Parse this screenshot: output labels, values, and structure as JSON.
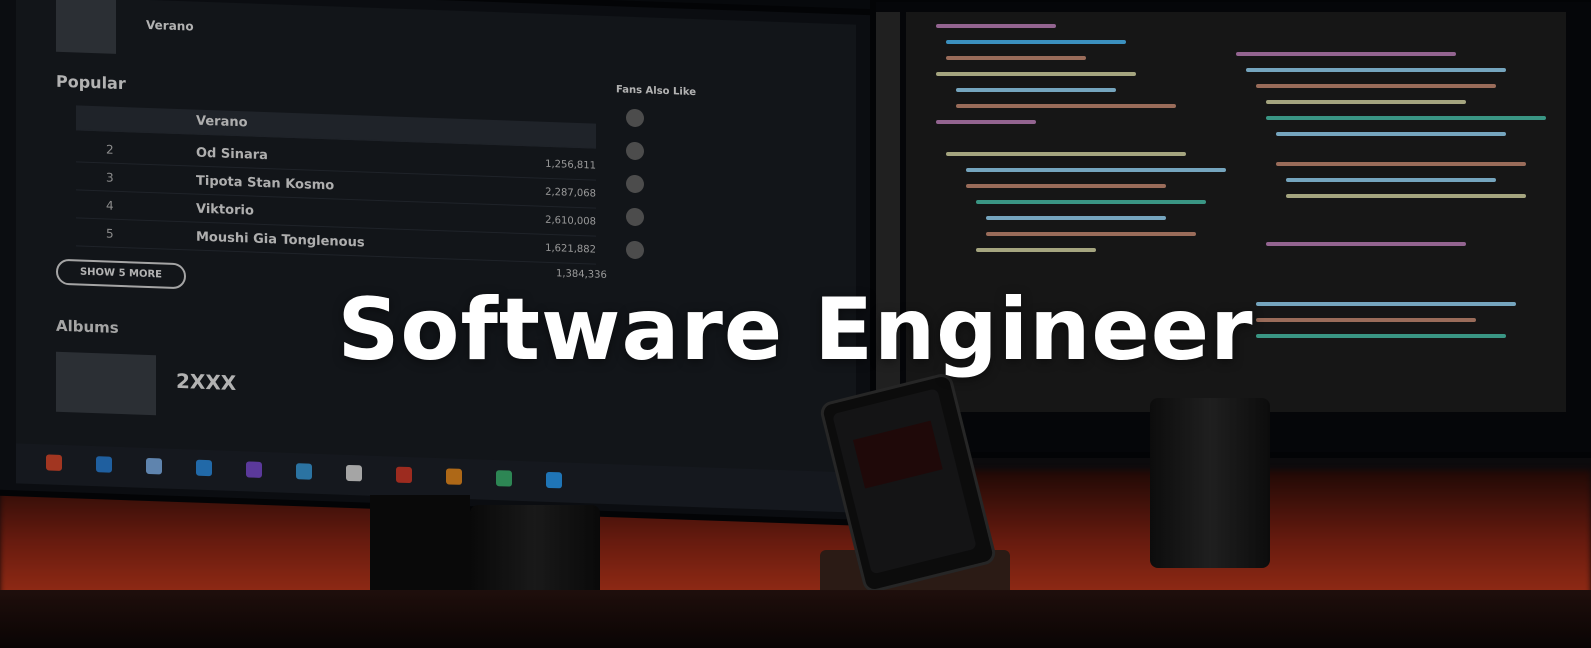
{
  "headline": "Software Engineer",
  "screen_text": {
    "left_monitor": {
      "artist": "Verano",
      "section_popular": "Popular",
      "tracks": [
        {
          "num": "",
          "name": "Verano",
          "plays": ""
        },
        {
          "num": "2",
          "name": "Od Sinara",
          "plays": "1,256,811"
        },
        {
          "num": "3",
          "name": "Tipota Stan Kosmo",
          "plays": "2,287,068"
        },
        {
          "num": "4",
          "name": "Viktorio",
          "plays": "2,610,008"
        },
        {
          "num": "5",
          "name": "Moushi Gia Tonglenous",
          "plays": "1,621,882"
        }
      ],
      "extra_plays": "1,384,336",
      "show_more": "SHOW 5 MORE",
      "section_albums": "Albums",
      "album_title": "2XXX",
      "fans_also_like": "Fans Also Like"
    }
  },
  "colors": {
    "headline": "#ffffff",
    "wall_glow": "#c2391c",
    "screen_bg": "#181c22"
  }
}
